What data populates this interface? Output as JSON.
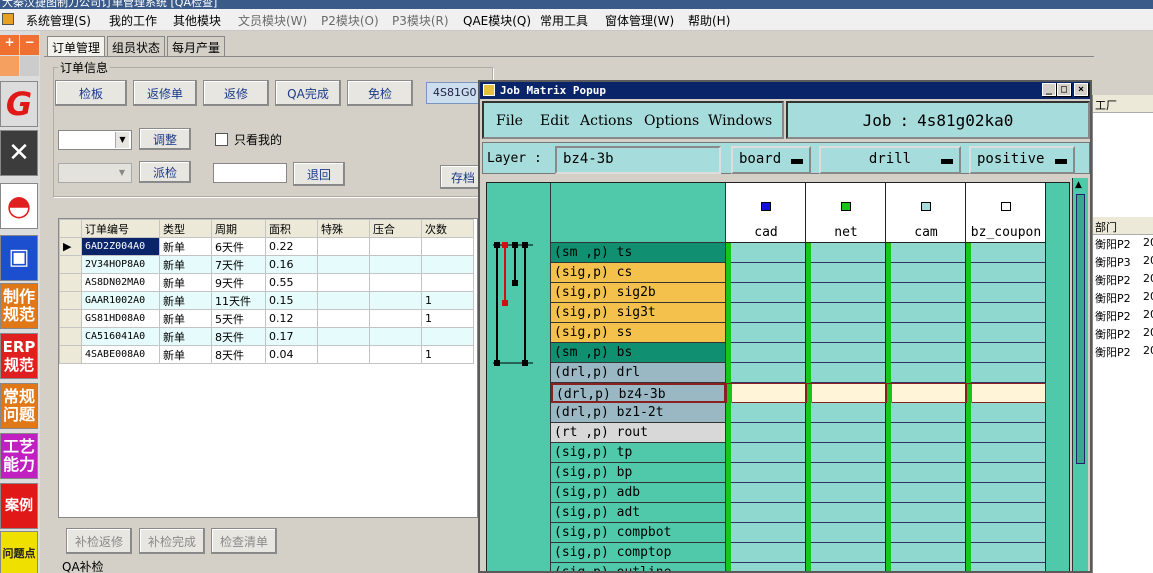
{
  "window": {
    "title_fragment": "大秦汉捷图制刀公司订单管理系统   [QA检查]"
  },
  "menu": [
    "系统管理(S)",
    "我的工作",
    "其他模块",
    "文员模块(W)",
    "P2模块(O)",
    "P3模块(R)",
    "QAE模块(Q)",
    "常用工具",
    "窗体管理(W)",
    "帮助(H)"
  ],
  "toolbar": {
    "plus": "+",
    "minus": "−",
    "items": [
      "制作规范",
      "ERP规范",
      "常规问题",
      "工艺能力",
      "案例",
      "问题点"
    ]
  },
  "tabs": [
    "订单管理",
    "组员状态",
    "每月产量"
  ],
  "order_info": {
    "group_label": "订单信息",
    "buttons": [
      "检板",
      "返修单",
      "返修",
      "QA完成",
      "免检"
    ],
    "job_tag": "4S81G0",
    "adjust_button": "调整",
    "only_mine": "只看我的",
    "send_check_button": "派检",
    "return_button": "退回",
    "archive_button": "存档"
  },
  "order_table": {
    "columns": [
      "订单编号",
      "类型",
      "周期",
      "面积",
      "特殊",
      "压合",
      "次数"
    ],
    "rows": [
      [
        "6AD2Z004A0",
        "新单",
        "6天件",
        "0.22",
        "",
        "",
        ""
      ],
      [
        "2V34HOP8A0",
        "新单",
        "7天件",
        "0.16",
        "",
        "",
        ""
      ],
      [
        "AS8DN02MA0",
        "新单",
        "9天件",
        "0.55",
        "",
        "",
        ""
      ],
      [
        "GAAR1002A0",
        "新单",
        "11天件",
        "0.15",
        "",
        "",
        "1"
      ],
      [
        "GS81HD08A0",
        "新单",
        "5天件",
        "0.12",
        "",
        "",
        "1"
      ],
      [
        "CA516041A0",
        "新单",
        "8天件",
        "0.17",
        "",
        "",
        ""
      ],
      [
        "4SABE008A0",
        "新单",
        "8天件",
        "0.04",
        "",
        "",
        "1"
      ]
    ]
  },
  "bottom_buttons": [
    "补检返修",
    "补检完成",
    "检查清单"
  ],
  "qa_label": "QA补检",
  "popup": {
    "title": "Job Matrix Popup",
    "menu": [
      "File",
      "Edit",
      "Actions",
      "Options",
      "Windows"
    ],
    "job_label": "Job",
    "job_value": "4s81g02ka0",
    "layer_label": "Layer :",
    "layer_value": "bz4-3b",
    "context_value": "board",
    "type_value": "drill",
    "polarity_value": "positive",
    "columns": [
      {
        "name": "cad",
        "color": "#1010d8"
      },
      {
        "name": "net",
        "color": "#19c419"
      },
      {
        "name": "cam",
        "color": "#a6dcdc"
      },
      {
        "name": "bz_coupon",
        "color": "#ffffff"
      }
    ],
    "layers": [
      {
        "label": "(sm ,p) ts",
        "color": "#109070"
      },
      {
        "label": "(sig,p) cs",
        "color": "#f4c24c"
      },
      {
        "label": "(sig,p) sig2b",
        "color": "#f4c24c"
      },
      {
        "label": "(sig,p) sig3t",
        "color": "#f4c24c"
      },
      {
        "label": "(sig,p) ss",
        "color": "#f4c24c"
      },
      {
        "label": "(sm ,p) bs",
        "color": "#109070"
      },
      {
        "label": "(drl,p) drl",
        "color": "#9ab8c4"
      },
      {
        "label": "(drl,p) bz4-3b",
        "color": "#9ab8c4"
      },
      {
        "label": "(drl,p) bz1-2t",
        "color": "#9ab8c4"
      },
      {
        "label": "(rt ,p) rout",
        "color": "#d8d8d8"
      },
      {
        "label": "(sig,p) tp",
        "color": "#4fc9aa"
      },
      {
        "label": "(sig,p) bp",
        "color": "#4fc9aa"
      },
      {
        "label": "(sig,p) adb",
        "color": "#4fc9aa"
      },
      {
        "label": "(sig,p) adt",
        "color": "#4fc9aa"
      },
      {
        "label": "(sig,p) compbot",
        "color": "#4fc9aa"
      },
      {
        "label": "(sig,p) comptop",
        "color": "#4fc9aa"
      },
      {
        "label": "(sig,p) outline",
        "color": "#4fc9aa"
      }
    ],
    "selected_layer": "bz4-3b"
  },
  "right_panel": {
    "header1": "工厂",
    "header2": "部门",
    "rows": [
      [
        "衡阳P2",
        "20"
      ],
      [
        "衡阳P3",
        "20"
      ],
      [
        "衡阳P2",
        "20"
      ],
      [
        "衡阳P2",
        "20"
      ],
      [
        "衡阳P2",
        "20"
      ],
      [
        "衡阳P2",
        "20"
      ],
      [
        "衡阳P2",
        "20"
      ]
    ]
  }
}
